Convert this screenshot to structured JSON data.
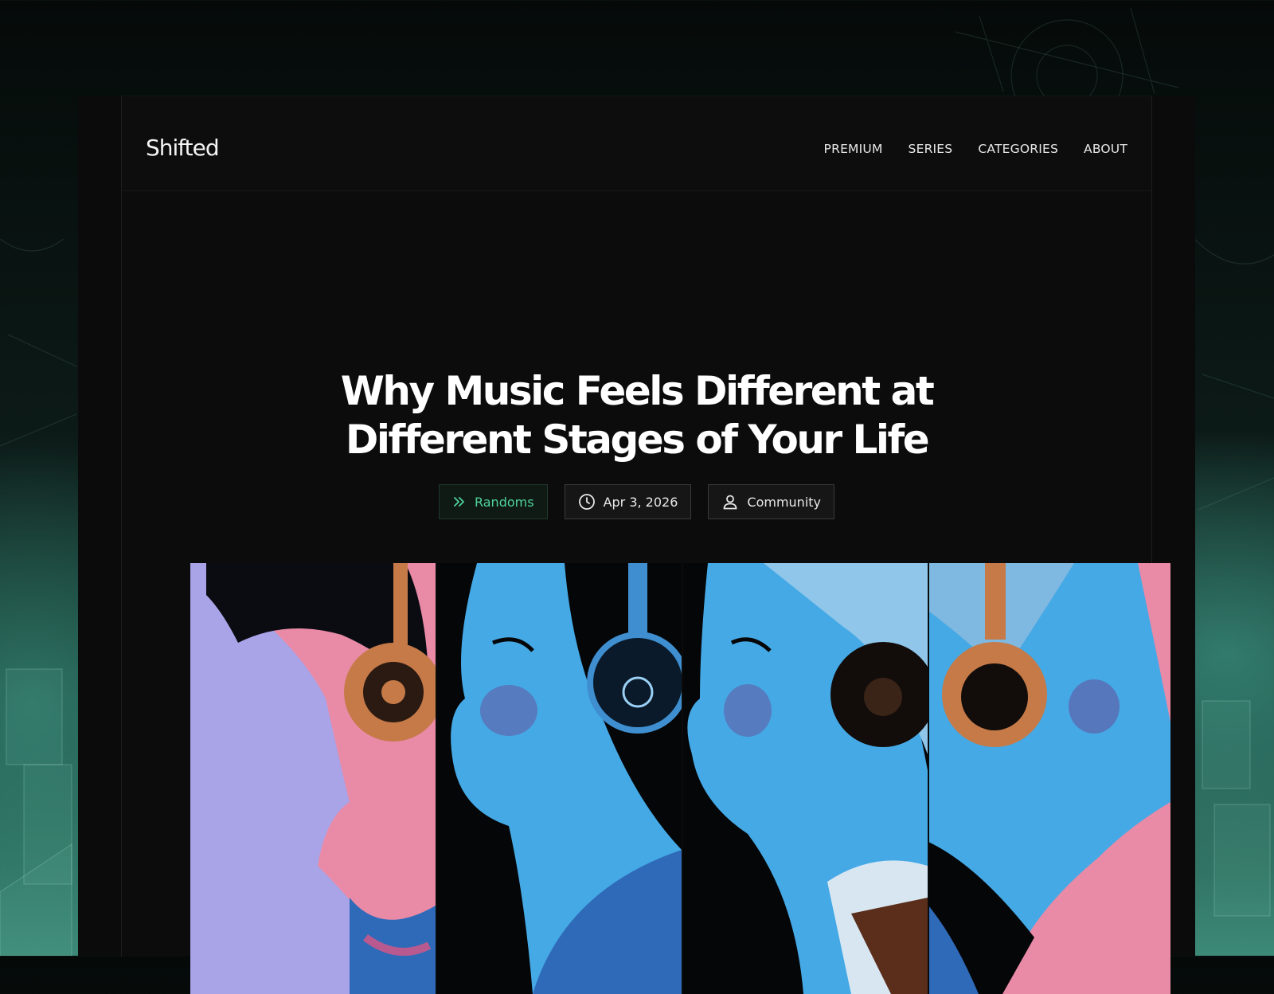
{
  "brand": {
    "name": "Shifted"
  },
  "nav": {
    "items": [
      {
        "label": "PREMIUM"
      },
      {
        "label": "SERIES"
      },
      {
        "label": "CATEGORIES"
      },
      {
        "label": "ABOUT"
      }
    ]
  },
  "article": {
    "title_line1": "Why Music Feels Different at",
    "title_line2": "Different Stages of Your Life",
    "category": {
      "label": "Randoms",
      "icon": "double-chevron-right-icon"
    },
    "date": {
      "label": "Apr 3, 2026",
      "icon": "clock-icon"
    },
    "author": {
      "label": "Community",
      "icon": "user-icon"
    }
  },
  "colors": {
    "accent": "#4fd29a",
    "card_bg": "#0b0b0b",
    "text": "#ffffff",
    "hero_pink": "#e98aa6",
    "hero_blue": "#45a9e6",
    "hero_lavender": "#a9a4e8",
    "hero_copper": "#c57a48"
  }
}
